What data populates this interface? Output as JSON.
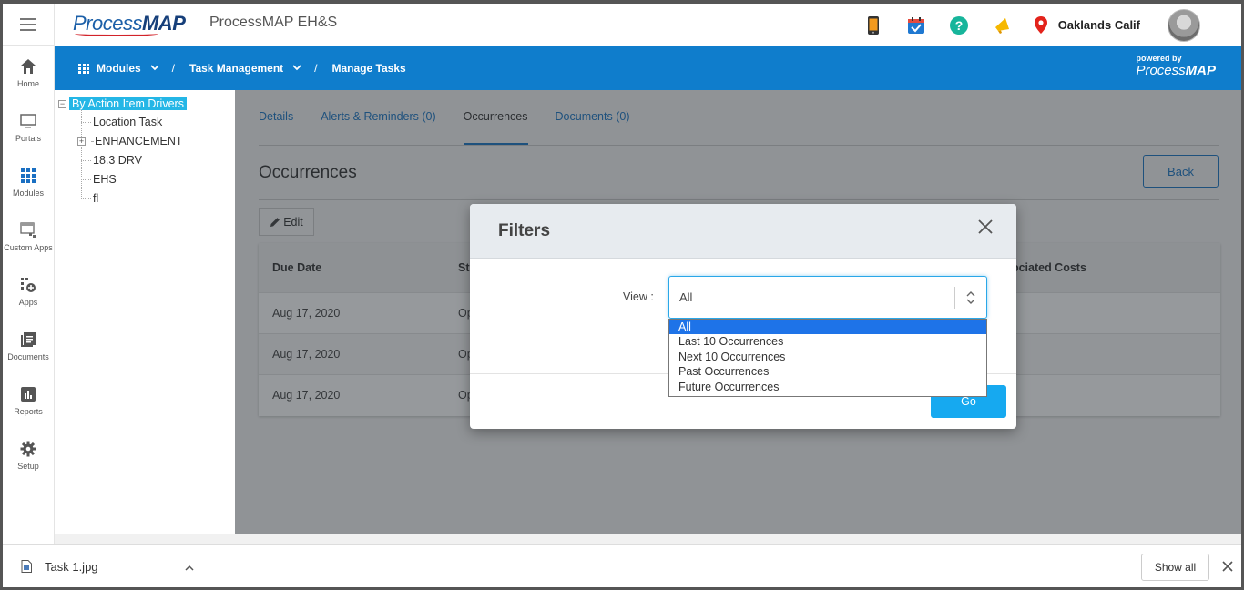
{
  "header": {
    "logo_text_light": "Process",
    "logo_text_bold": "MAP",
    "app_title": "ProcessMAP EH&S",
    "location": "Oaklands Calif"
  },
  "rail": {
    "items": [
      {
        "label": "Home",
        "icon": "home-icon"
      },
      {
        "label": "Portals",
        "icon": "monitor-icon"
      },
      {
        "label": "Modules",
        "icon": "grid-icon"
      },
      {
        "label": "Custom Apps",
        "icon": "custom-apps-icon"
      },
      {
        "label": "Apps",
        "icon": "apps-add-icon"
      },
      {
        "label": "Documents",
        "icon": "documents-icon"
      },
      {
        "label": "Reports",
        "icon": "reports-icon"
      },
      {
        "label": "Setup",
        "icon": "gear-icon"
      }
    ]
  },
  "nav": {
    "modules": "Modules",
    "task_management": "Task Management",
    "current": "Manage Tasks",
    "sep": "/",
    "powered_by": "powered by",
    "powered_light": "Process",
    "powered_bold": "MAP"
  },
  "tree": {
    "root": "By Action Item Drivers",
    "nodes": [
      "Location Task",
      "ENHANCEMENT",
      "18.3 DRV",
      "EHS",
      "fl"
    ]
  },
  "tabs": [
    {
      "label": "Details"
    },
    {
      "label": "Alerts & Reminders (0)"
    },
    {
      "label": "Occurrences"
    },
    {
      "label": "Documents (0)"
    }
  ],
  "page": {
    "title": "Occurrences",
    "back_label": "Back",
    "edit_label": "Edit"
  },
  "table": {
    "headers": [
      "Due Date",
      "St",
      "sociated Costs"
    ],
    "rows": [
      [
        "Aug 17, 2020",
        "Op"
      ],
      [
        "Aug 17, 2020",
        "Op"
      ],
      [
        "Aug 17, 2020",
        "Op"
      ]
    ]
  },
  "modal": {
    "title": "Filters",
    "view_label": "View :",
    "view_value": "All",
    "go_label": "Go",
    "options": [
      "All",
      "Last 10 Occurrences",
      "Next 10 Occurrences",
      "Past Occurrences",
      "Future Occurrences"
    ]
  },
  "downloads": {
    "file_name": "Task 1.jpg",
    "show_all": "Show all"
  },
  "colors": {
    "nav_blue": "#0f7dcc",
    "tree_highlight": "#24b6e6",
    "go_button": "#16a9f0",
    "dropdown_selected": "#1e73e8"
  }
}
